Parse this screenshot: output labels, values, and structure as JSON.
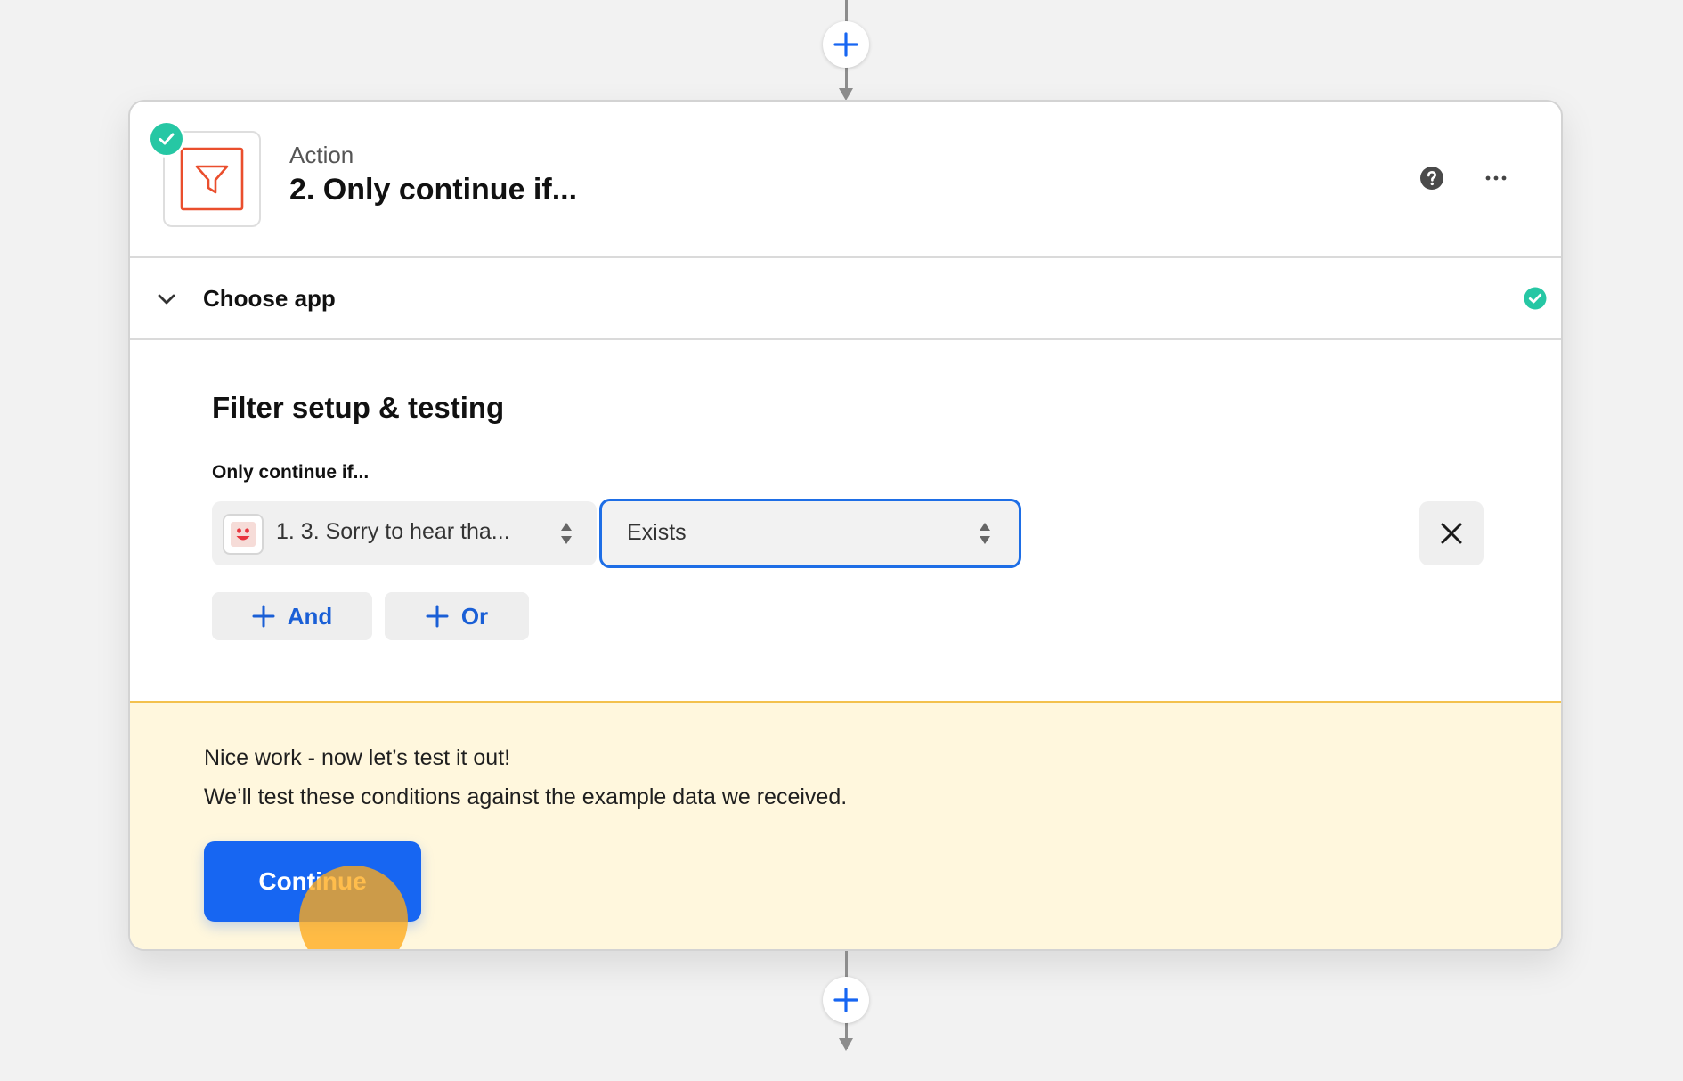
{
  "step": {
    "type_label": "Action",
    "title": "2. Only continue if..."
  },
  "choose_app": {
    "label": "Choose app"
  },
  "filter": {
    "section_title": "Filter setup & testing",
    "field_label": "Only continue if...",
    "field_value": "1. 3. Sorry to hear tha...",
    "condition_value": "Exists",
    "and_label": "And",
    "or_label": "Or"
  },
  "test_panel": {
    "line1": "Nice work - now let’s test it out!",
    "line2": "We’ll test these conditions against the example data we received.",
    "continue_label": "Continue"
  },
  "icons": {
    "app": "filter-funnel-icon",
    "status": "check-circle-icon",
    "help": "help-circle-icon",
    "more": "more-horizontal-icon",
    "field_app": "smiley-face-icon",
    "remove": "close-icon"
  },
  "colors": {
    "accent": "#1766f2",
    "success": "#26c7a4",
    "filter_orange": "#ea4e2d",
    "panel_bg": "#fff7dd",
    "panel_border": "#f3c14d",
    "highlight": "#ffaa19"
  }
}
